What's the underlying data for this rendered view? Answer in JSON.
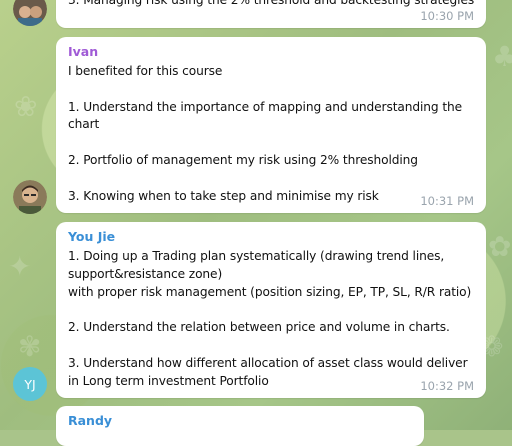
{
  "messages": [
    {
      "sender": "",
      "text": "3. Managing risk using the 2% threshold and backtesting strategies",
      "time": "10:30 PM"
    },
    {
      "sender": "Ivan",
      "sender_color": "#a05bd6",
      "text": "I benefited for this course\n\n1. Understand the importance of mapping and understanding the chart\n\n2. Portfolio of management my risk using 2% thresholding\n\n3. Knowing when to take step and minimise my risk",
      "time": "10:31 PM"
    },
    {
      "sender": "You Jie",
      "sender_color": "#3a8fd6",
      "avatar_initials": "YJ",
      "text": "1. Doing up a Trading plan systematically (drawing trend lines, support&resistance zone)\nwith proper risk management (position sizing, EP, TP, SL, R/R ratio)\n\n2. Understand the relation between price and volume in charts.\n\n3. Understand how different allocation of asset class would deliver in Long term investment Portfolio",
      "time": "10:32 PM"
    },
    {
      "sender": "Randy",
      "sender_color": "#3a8fd6"
    }
  ]
}
